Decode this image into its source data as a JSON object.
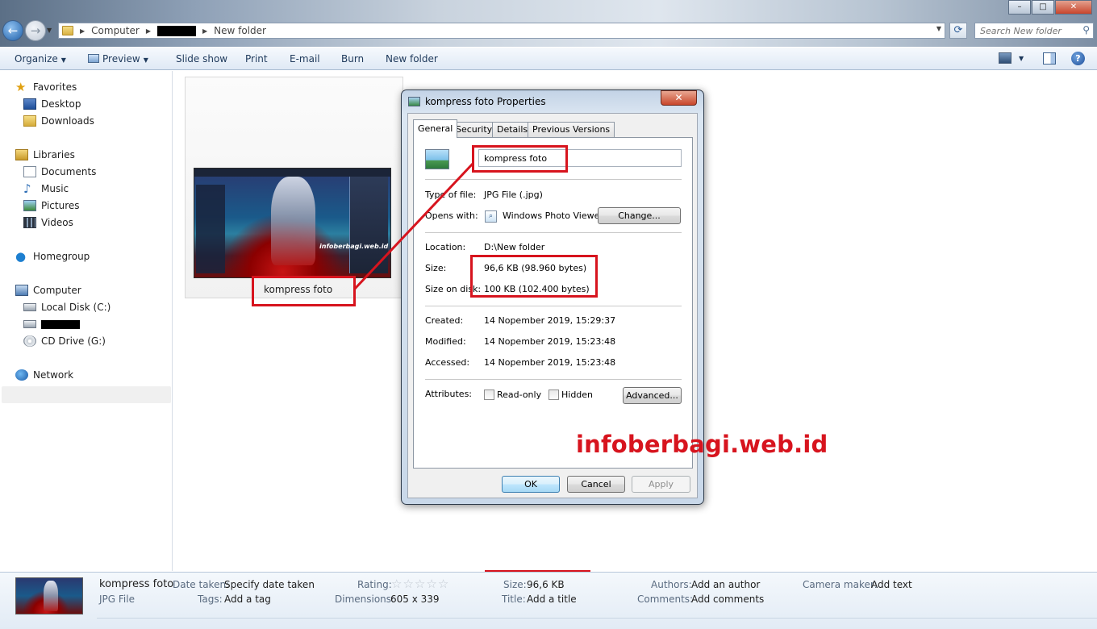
{
  "window": {
    "minimize": "–",
    "maximize": "□",
    "close": "✕"
  },
  "address": {
    "crumb_computer": "Computer",
    "crumb_current": "New folder",
    "search_placeholder": "Search New folder"
  },
  "toolbar": {
    "organize": "Organize",
    "preview": "Preview",
    "slideshow": "Slide show",
    "print": "Print",
    "email": "E-mail",
    "burn": "Burn",
    "new_folder": "New folder"
  },
  "nav": {
    "favorites": "Favorites",
    "desktop": "Desktop",
    "downloads": "Downloads",
    "libraries": "Libraries",
    "documents": "Documents",
    "music": "Music",
    "pictures": "Pictures",
    "videos": "Videos",
    "homegroup": "Homegroup",
    "computer": "Computer",
    "local_disk": "Local Disk (C:)",
    "cd_drive": "CD Drive (G:)",
    "network": "Network"
  },
  "content": {
    "file_label": "kompress foto",
    "thumb_watermark": "infoberbagi.web.id"
  },
  "dialog": {
    "title": "kompress foto Properties",
    "close": "✕",
    "tabs": [
      "General",
      "Security",
      "Details",
      "Previous Versions"
    ],
    "name_value": "kompress foto",
    "type_label": "Type of file:",
    "type_value": "JPG File (.jpg)",
    "opens_label": "Opens with:",
    "opens_value": "Windows Photo Viewer",
    "change_btn": "Change...",
    "location_label": "Location:",
    "location_value": "D:\\New folder",
    "size_label": "Size:",
    "size_value": "96,6 KB (98.960 bytes)",
    "size_disk_label": "Size on disk:",
    "size_disk_value": "100 KB (102.400 bytes)",
    "created_label": "Created:",
    "created_value": "14 Nopember 2019, 15:29:37",
    "modified_label": "Modified:",
    "modified_value": "14 Nopember 2019, 15:23:48",
    "accessed_label": "Accessed:",
    "accessed_value": "14 Nopember 2019, 15:23:48",
    "attributes_label": "Attributes:",
    "readonly_label": "Read-only",
    "readonly_checked": false,
    "hidden_label": "Hidden",
    "hidden_checked": false,
    "advanced_btn": "Advanced...",
    "ok_btn": "OK",
    "cancel_btn": "Cancel",
    "apply_btn": "Apply"
  },
  "watermark": "infoberbagi.web.id",
  "details": {
    "name": "kompress foto",
    "type": "JPG File",
    "date_taken_label": "Date taken:",
    "date_taken_value": "Specify date taken",
    "tags_label": "Tags:",
    "tags_value": "Add a tag",
    "rating_label": "Rating:",
    "rating_stars": 0,
    "dimensions_label": "Dimensions:",
    "dimensions_value": "605 x 339",
    "size_label": "Size:",
    "size_value": "96,6 KB",
    "title_label": "Title:",
    "title_value": "Add a title",
    "authors_label": "Authors:",
    "authors_value": "Add an author",
    "comments_label": "Comments:",
    "comments_value": "Add comments",
    "camera_label": "Camera maker:",
    "camera_value": "Add text"
  },
  "colors": {
    "annotation_red": "#d7141e",
    "toolbar_text": "#1e395b",
    "details_label": "#5a6b80"
  }
}
